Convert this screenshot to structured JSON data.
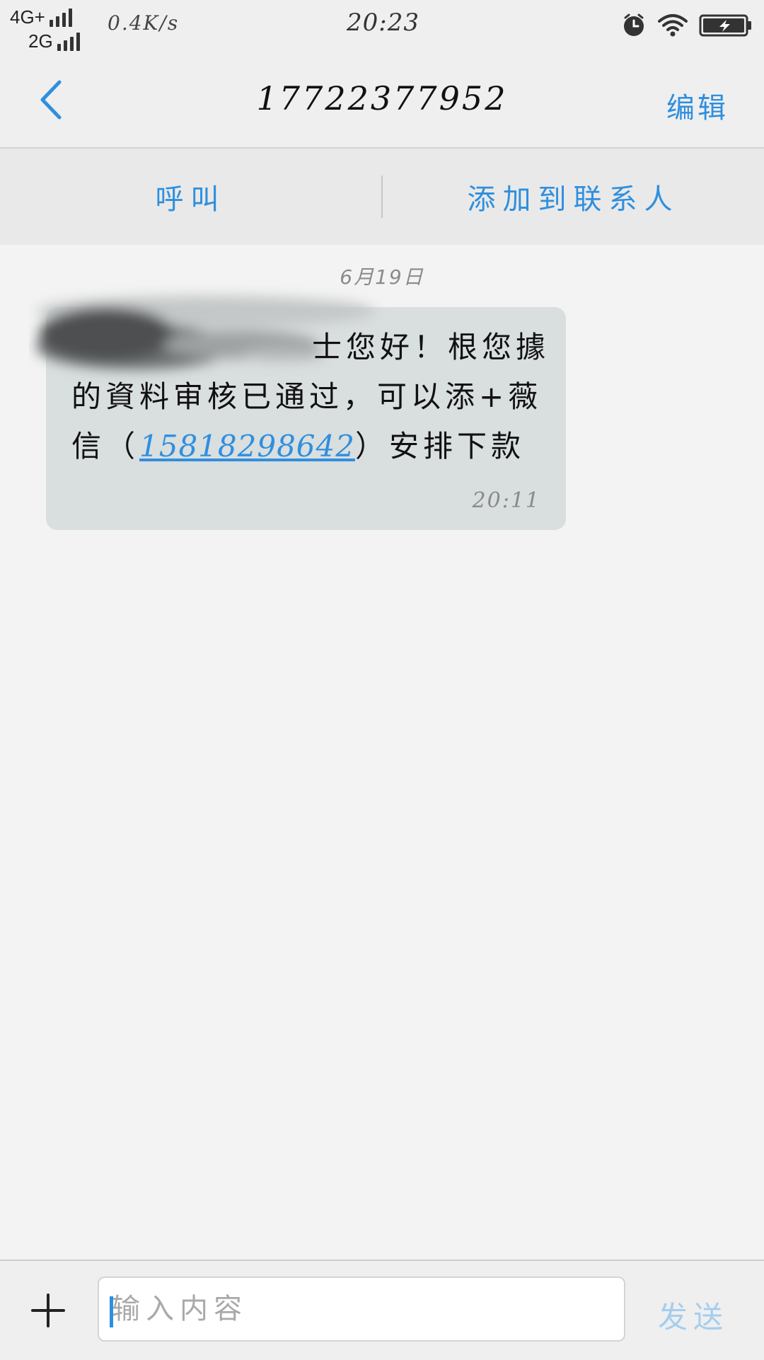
{
  "status_bar": {
    "network_primary": "4G+",
    "network_secondary": "2G",
    "net_speed": "0.4K/s",
    "time": "20:23",
    "icons": [
      "signal-icon",
      "alarm-icon",
      "wifi-icon",
      "battery-charging-icon"
    ]
  },
  "header": {
    "title": "17722377952",
    "edit_label": "编辑",
    "back_icon": "chevron-left-icon"
  },
  "actions": {
    "call_label": "呼叫",
    "add_contact_label": "添加到联系人"
  },
  "conversation": {
    "date": "6月19日",
    "messages": [
      {
        "line1": "士您好！根您據",
        "line2": "的資料审核已通过，可以添+薇",
        "line3_prefix": "信（",
        "phone": "15818298642",
        "line3_suffix": "）安排下款",
        "time": "20:11"
      }
    ]
  },
  "composer": {
    "placeholder": "输入内容",
    "send_label": "发送",
    "add_icon": "plus-icon"
  },
  "colors": {
    "accent": "#2f8fde",
    "bubble": "#d9dedf",
    "background": "#f3f3f3",
    "send_disabled": "#a6cdee"
  }
}
